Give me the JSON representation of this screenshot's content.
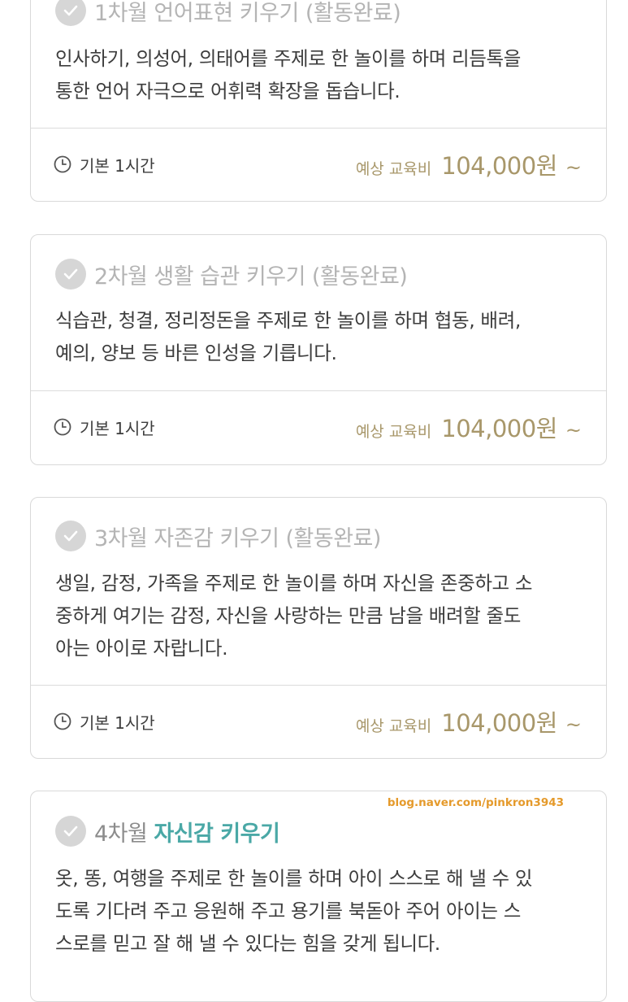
{
  "cards": [
    {
      "month": "1차월",
      "topic": "언어표현 키우기",
      "status": "(활동완료)",
      "description": [
        "인사하기, 의성어, 의태어를 주제로 한 놀이를 하며 리듬톡을",
        "통한 언어 자극으로 어휘력 확장을 돕습니다."
      ],
      "duration": "기본 1시간",
      "price_label": "예상 교육비",
      "price": "104,000원",
      "price_suffix": "~"
    },
    {
      "month": "2차월",
      "topic": "생활 습관 키우기",
      "status": "(활동완료)",
      "description": [
        "식습관, 청결, 정리정돈을 주제로 한 놀이를 하며 협동, 배려,",
        "예의, 양보 등 바른 인성을 기릅니다."
      ],
      "duration": "기본 1시간",
      "price_label": "예상 교육비",
      "price": "104,000원",
      "price_suffix": "~"
    },
    {
      "month": "3차월",
      "topic": "자존감 키우기",
      "status": "(활동완료)",
      "description": [
        "생일, 감정, 가족을 주제로 한 놀이를 하며 자신을 존중하고 소",
        "중하게 여기는 감정, 자신을 사랑하는 만큼 남을 배려할 줄도",
        "아는 아이로 자랍니다."
      ],
      "duration": "기본 1시간",
      "price_label": "예상 교육비",
      "price": "104,000원",
      "price_suffix": "~"
    },
    {
      "month": "4차월",
      "topic": "자신감 키우기",
      "description": [
        "옷, 똥, 여행을 주제로 한 놀이를 하며 아이 스스로 해 낼 수 있",
        "도록 기다려 주고 응원해 주고 용기를 북돋아 주어 아이는 스",
        "스로를 믿고 잘 해 낼 수 있다는 힘을 갖게 됩니다."
      ],
      "watermark": "blog.naver.com/pinkron3943"
    }
  ],
  "icons": {
    "check": "check-circle-icon",
    "clock": "clock-icon"
  },
  "colors": {
    "accent": "#4aa8a6",
    "price": "#a8976a",
    "done": "#b4b4b4",
    "watermark": "#e59a2b"
  }
}
